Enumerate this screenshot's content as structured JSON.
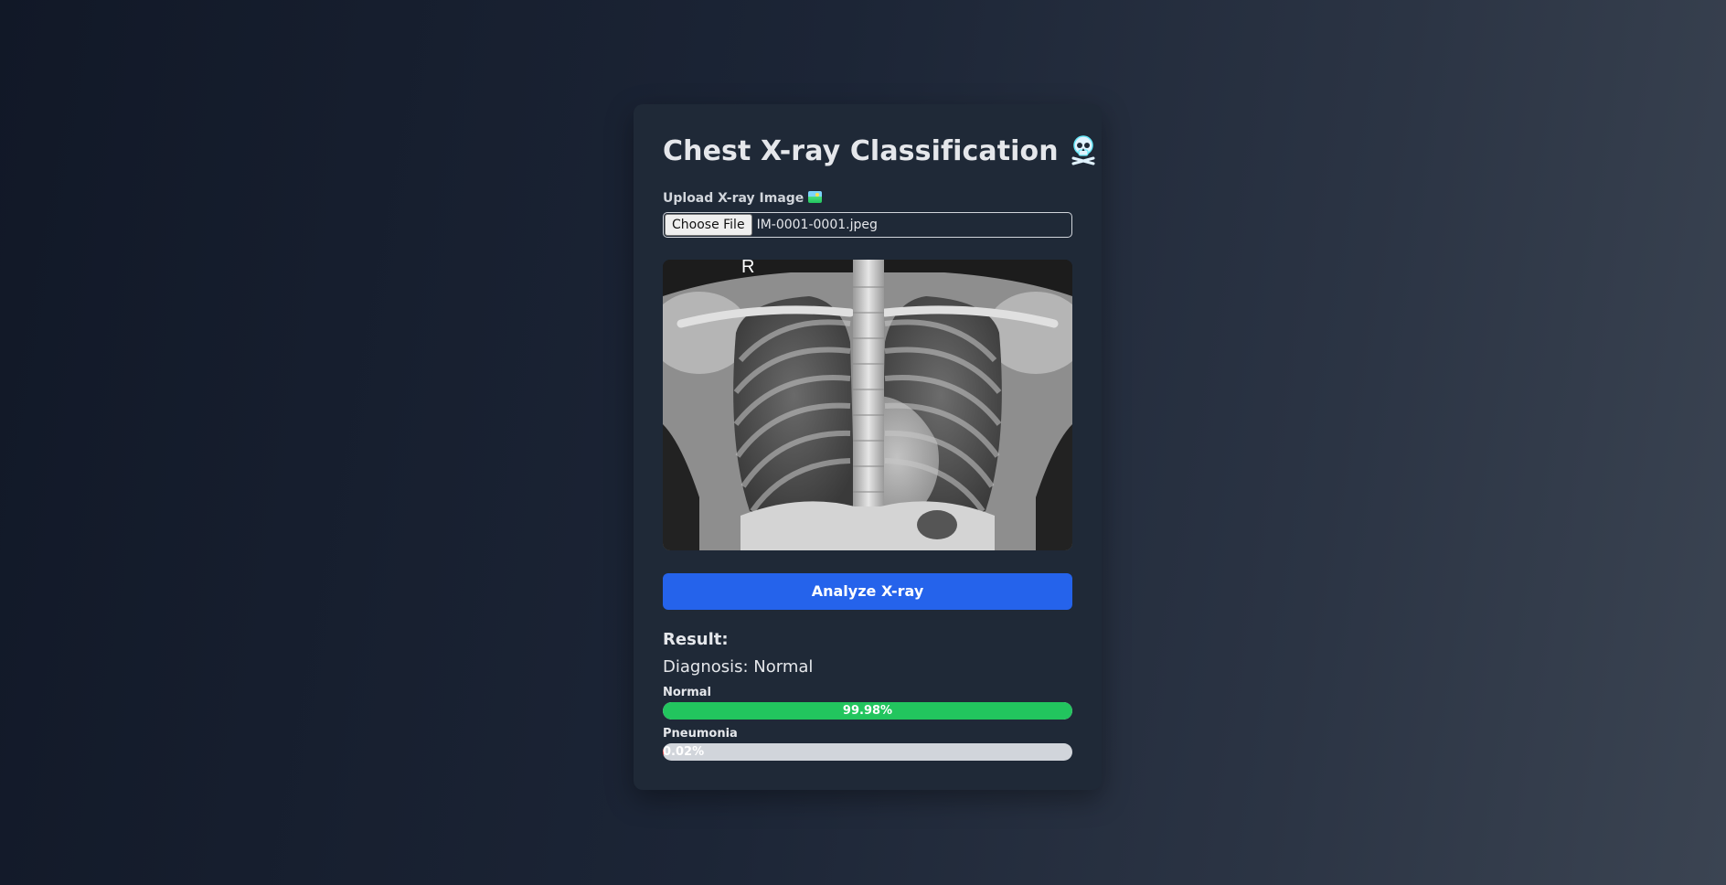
{
  "app": {
    "title": "Chest X-ray Classification",
    "title_icon": "skull-and-crossbones-icon"
  },
  "upload": {
    "label": "Upload X-ray Image",
    "label_icon": "framed-picture-icon",
    "button_label": "Choose File",
    "file_name": "IM-0001-0001.jpeg"
  },
  "preview": {
    "marker": "R",
    "image_desc": "chest-xray-preview"
  },
  "actions": {
    "analyze_label": "Analyze X-ray"
  },
  "result": {
    "heading": "Result:",
    "diagnosis": "Diagnosis: Normal",
    "probabilities": [
      {
        "label": "Normal",
        "percent_text": "99.98%",
        "value": 99.98,
        "color": "#22c55e"
      },
      {
        "label": "Pneumonia",
        "percent_text": "0.02%",
        "value": 0.02,
        "color": "#ef4444"
      }
    ]
  },
  "colors": {
    "accent": "#2563eb",
    "card": "#1f2937",
    "track": "#d1d5db"
  }
}
